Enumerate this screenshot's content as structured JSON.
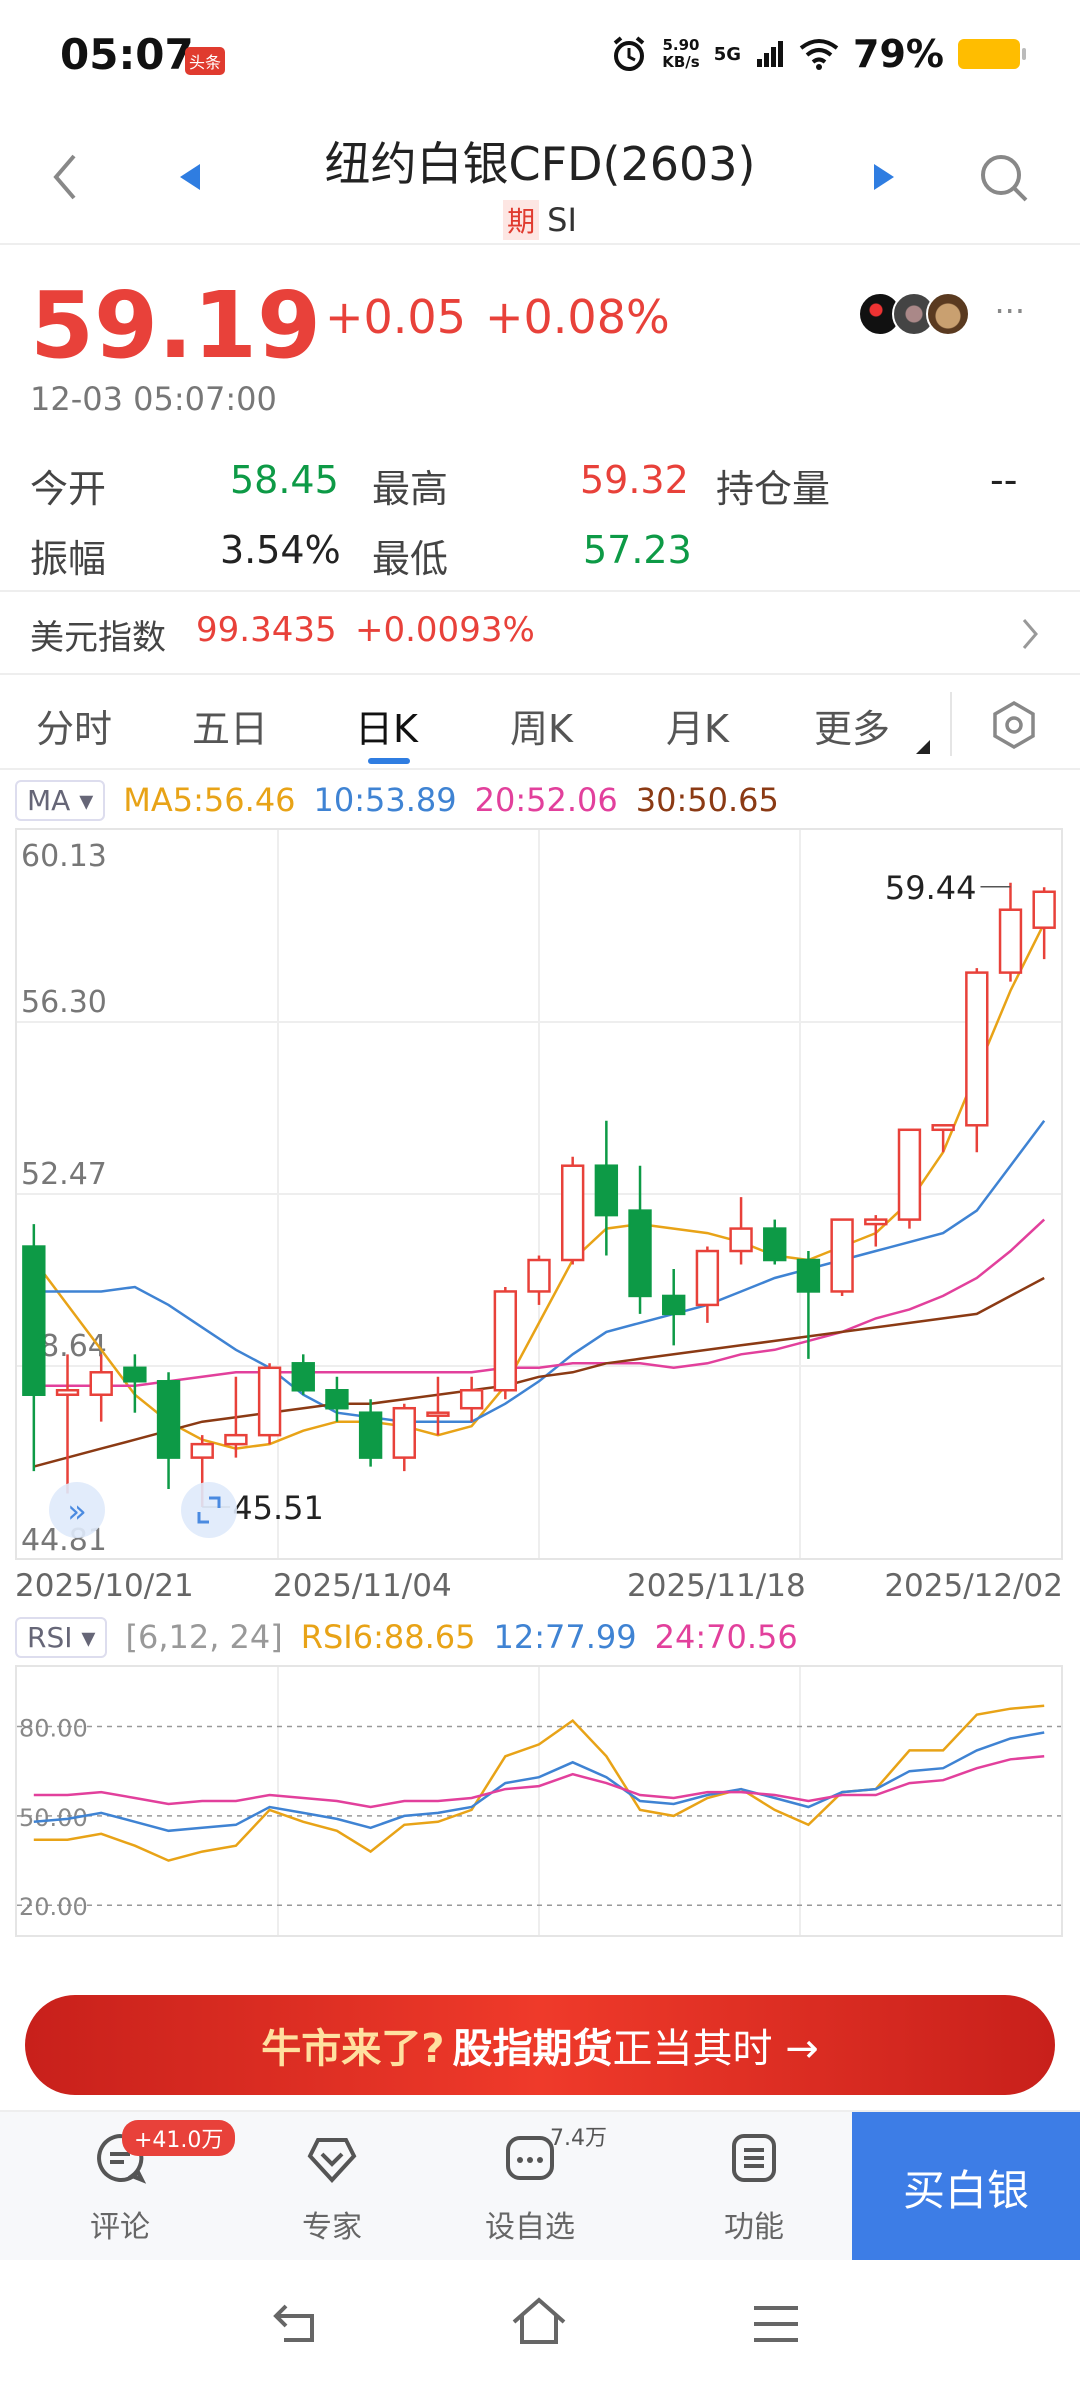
{
  "status": {
    "time": "05:07",
    "badge": "头条",
    "net_speed": "5.90",
    "net_unit": "KB/s",
    "signal": "5G",
    "battery_pct": "79%"
  },
  "header": {
    "title": "纽约白银CFD(2603)",
    "badge": "期",
    "symbol": "SI"
  },
  "quote": {
    "price": "59.19",
    "change": "+0.05",
    "change_pct": "+0.08%",
    "timestamp": "12-03 05:07:00"
  },
  "stats": {
    "open_label": "今开",
    "open": "58.45",
    "high_label": "最高",
    "high": "59.32",
    "oi_label": "持仓量",
    "oi": "--",
    "amp_label": "振幅",
    "amp": "3.54%",
    "low_label": "最低",
    "low": "57.23"
  },
  "usd_index": {
    "label": "美元指数",
    "value": "99.3435",
    "change": "+0.0093%"
  },
  "tabs": [
    "分时",
    "五日",
    "日K",
    "周K",
    "月K",
    "更多"
  ],
  "ma": {
    "selector": "MA",
    "ma5": "MA5:56.46",
    "ma10": "10:53.89",
    "ma20": "20:52.06",
    "ma30": "30:50.65"
  },
  "rsi": {
    "selector": "RSI",
    "params": "[6,12, 24]",
    "rsi6": "RSI6:88.65",
    "rsi12": "12:77.99",
    "rsi24": "24:70.56"
  },
  "colors": {
    "up": "#e8413a",
    "down": "#0d9a46",
    "ma5": "#e8a317",
    "ma10": "#3f83d3",
    "ma20": "#e2409c",
    "ma30": "#8b3a14"
  },
  "chart_data": {
    "type": "candlestick",
    "y_ticks": [
      "60.13",
      "56.30",
      "52.47",
      "48.64",
      "44.81"
    ],
    "x_ticks": [
      "2025/10/21",
      "2025/11/04",
      "2025/11/18",
      "2025/12/02"
    ],
    "ylim": [
      44.81,
      60.13
    ],
    "max_label": "59.44",
    "min_label": "45.51",
    "candles": [
      {
        "o": 51.3,
        "h": 51.8,
        "l": 46.3,
        "c": 48.0
      },
      {
        "o": 48.0,
        "h": 48.9,
        "l": 45.8,
        "c": 48.1
      },
      {
        "o": 48.0,
        "h": 48.9,
        "l": 47.4,
        "c": 48.5
      },
      {
        "o": 48.6,
        "h": 48.9,
        "l": 47.6,
        "c": 48.3
      },
      {
        "o": 48.3,
        "h": 48.5,
        "l": 45.9,
        "c": 46.6
      },
      {
        "o": 46.6,
        "h": 47.1,
        "l": 45.5,
        "c": 46.9
      },
      {
        "o": 46.9,
        "h": 48.4,
        "l": 46.6,
        "c": 47.1
      },
      {
        "o": 47.1,
        "h": 48.7,
        "l": 46.9,
        "c": 48.6
      },
      {
        "o": 48.7,
        "h": 48.9,
        "l": 48.0,
        "c": 48.1
      },
      {
        "o": 48.1,
        "h": 48.4,
        "l": 47.4,
        "c": 47.7
      },
      {
        "o": 47.6,
        "h": 47.9,
        "l": 46.4,
        "c": 46.6
      },
      {
        "o": 46.6,
        "h": 47.8,
        "l": 46.3,
        "c": 47.7
      },
      {
        "o": 47.6,
        "h": 48.4,
        "l": 47.1,
        "c": 47.6
      },
      {
        "o": 47.7,
        "h": 48.4,
        "l": 47.4,
        "c": 48.1
      },
      {
        "o": 48.1,
        "h": 50.4,
        "l": 47.9,
        "c": 50.3
      },
      {
        "o": 50.3,
        "h": 51.1,
        "l": 50.0,
        "c": 51.0
      },
      {
        "o": 51.0,
        "h": 53.3,
        "l": 50.9,
        "c": 53.1
      },
      {
        "o": 53.1,
        "h": 54.1,
        "l": 51.1,
        "c": 52.0
      },
      {
        "o": 52.1,
        "h": 53.1,
        "l": 49.8,
        "c": 50.2
      },
      {
        "o": 50.2,
        "h": 50.8,
        "l": 49.1,
        "c": 49.8
      },
      {
        "o": 50.0,
        "h": 51.3,
        "l": 49.6,
        "c": 51.2
      },
      {
        "o": 51.2,
        "h": 52.4,
        "l": 50.9,
        "c": 51.7
      },
      {
        "o": 51.7,
        "h": 51.9,
        "l": 50.9,
        "c": 51.0
      },
      {
        "o": 51.0,
        "h": 51.2,
        "l": 48.8,
        "c": 50.3
      },
      {
        "o": 50.3,
        "h": 51.9,
        "l": 50.2,
        "c": 51.9
      },
      {
        "o": 51.8,
        "h": 52.0,
        "l": 51.3,
        "c": 51.9
      },
      {
        "o": 51.9,
        "h": 53.9,
        "l": 51.7,
        "c": 53.9
      },
      {
        "o": 53.9,
        "h": 54.0,
        "l": 53.4,
        "c": 54.0
      },
      {
        "o": 54.0,
        "h": 57.5,
        "l": 53.4,
        "c": 57.4
      },
      {
        "o": 57.4,
        "h": 59.4,
        "l": 57.2,
        "c": 58.8
      },
      {
        "o": 58.4,
        "h": 59.3,
        "l": 57.7,
        "c": 59.2
      }
    ],
    "series": [
      {
        "name": "MA5",
        "values": [
          51.0,
          50.0,
          49.0,
          48.0,
          47.4,
          47.0,
          46.8,
          46.9,
          47.2,
          47.4,
          47.4,
          47.3,
          47.1,
          47.3,
          48.2,
          49.6,
          51.0,
          51.7,
          51.8,
          51.7,
          51.6,
          51.4,
          51.1,
          51.0,
          51.3,
          51.6,
          52.3,
          53.4,
          55.2,
          57.0,
          58.5
        ]
      },
      {
        "name": "MA10",
        "values": [
          50.3,
          50.3,
          50.3,
          50.4,
          50.0,
          49.5,
          49.0,
          48.6,
          48.0,
          47.6,
          47.5,
          47.4,
          47.4,
          47.4,
          47.8,
          48.3,
          48.9,
          49.4,
          49.6,
          49.8,
          50.0,
          50.3,
          50.6,
          50.8,
          51.0,
          51.2,
          51.4,
          51.6,
          52.1,
          53.1,
          54.1
        ]
      },
      {
        "name": "MA20",
        "values": [
          48.2,
          48.2,
          48.2,
          48.2,
          48.3,
          48.4,
          48.5,
          48.5,
          48.5,
          48.5,
          48.5,
          48.5,
          48.5,
          48.5,
          48.6,
          48.6,
          48.7,
          48.7,
          48.7,
          48.6,
          48.7,
          48.9,
          49.0,
          49.2,
          49.4,
          49.7,
          49.9,
          50.2,
          50.6,
          51.2,
          51.9
        ]
      },
      {
        "name": "MA30",
        "values": [
          46.4,
          46.6,
          46.8,
          47.0,
          47.2,
          47.4,
          47.5,
          47.6,
          47.7,
          47.8,
          47.8,
          47.9,
          48.0,
          48.1,
          48.2,
          48.4,
          48.5,
          48.7,
          48.8,
          48.9,
          49.0,
          49.1,
          49.2,
          49.3,
          49.4,
          49.5,
          49.6,
          49.7,
          49.8,
          50.2,
          50.6
        ]
      }
    ],
    "rsi": {
      "y_ticks": [
        "80.00",
        "50.00",
        "20.00"
      ],
      "ylim": [
        10,
        100
      ],
      "series": [
        {
          "name": "RSI6",
          "values": [
            42,
            42,
            44,
            40,
            35,
            38,
            40,
            52,
            48,
            45,
            38,
            47,
            48,
            52,
            70,
            74,
            82,
            70,
            52,
            50,
            56,
            59,
            52,
            47,
            58,
            59,
            72,
            72,
            84,
            86,
            87
          ]
        },
        {
          "name": "RSI12",
          "values": [
            48,
            49,
            51,
            48,
            45,
            46,
            47,
            53,
            51,
            49,
            46,
            50,
            51,
            53,
            61,
            63,
            68,
            63,
            55,
            54,
            57,
            59,
            56,
            53,
            58,
            59,
            65,
            66,
            72,
            76,
            78
          ]
        },
        {
          "name": "RSI24",
          "values": [
            57,
            57,
            58,
            56,
            54,
            55,
            55,
            57,
            56,
            55,
            53,
            55,
            55,
            56,
            59,
            60,
            64,
            61,
            57,
            56,
            58,
            58,
            57,
            55,
            57,
            57,
            61,
            62,
            66,
            69,
            70
          ]
        }
      ]
    }
  },
  "banner": {
    "highlight": "牛市来了?",
    "bold": "股指期货",
    "text": "正当其时 →"
  },
  "bottom_nav": {
    "comment": "评论",
    "comment_count": "+41.0万",
    "expert": "专家",
    "watch": "设自选",
    "watch_count": "7.4万",
    "func": "功能",
    "buy": "买白银"
  }
}
